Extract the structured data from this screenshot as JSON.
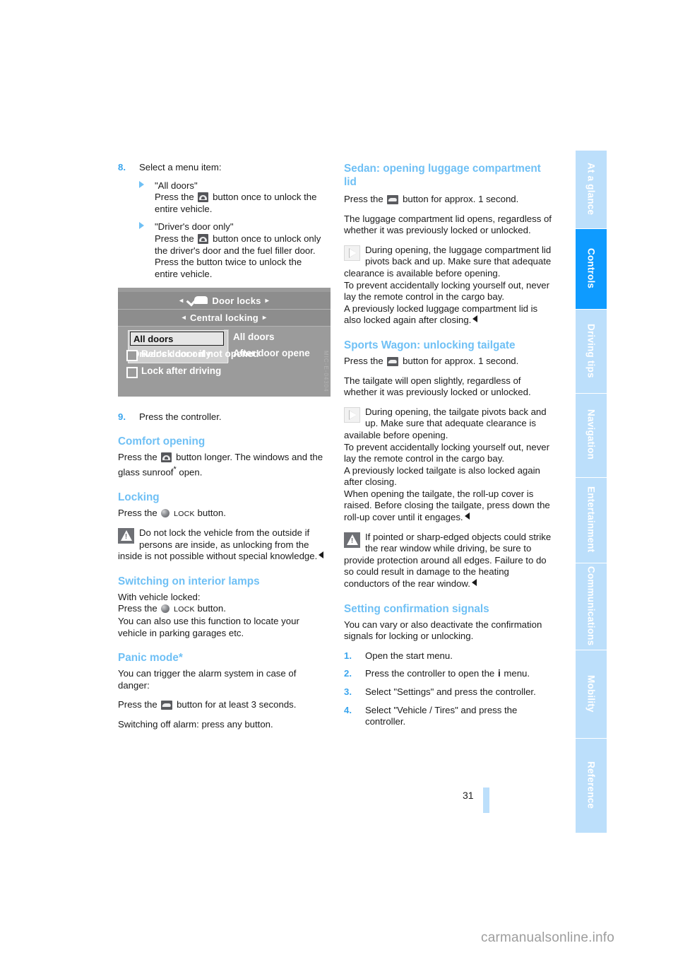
{
  "document": {
    "page_number": "31",
    "watermark": "carmanualsonline.info"
  },
  "tabs": [
    {
      "label": "At a glance",
      "active": false
    },
    {
      "label": "Controls",
      "active": true
    },
    {
      "label": "Driving tips",
      "active": false
    },
    {
      "label": "Navigation",
      "active": false
    },
    {
      "label": "Entertainment",
      "active": false
    },
    {
      "label": "Communications",
      "active": false
    },
    {
      "label": "Mobility",
      "active": false
    },
    {
      "label": "Reference",
      "active": false
    }
  ],
  "colors": {
    "accent_heading": "#6fc0f5",
    "tab_inactive": "#bcdffb",
    "tab_active": "#0e9bff",
    "number_blue": "#3aa5ee"
  },
  "left_column": {
    "step8": {
      "number": "8.",
      "text": "Select a menu item:"
    },
    "bullets": [
      {
        "title": "\"All doors\"",
        "line1_before": "Press the",
        "line1_after": "button once to unlock the",
        "line2": "entire vehicle."
      },
      {
        "title": "\"Driver's door only\"",
        "line1_before": "Press the",
        "line1_after": "button once to unlock only",
        "line2": "the driver's door and the fuel filler door.",
        "line3": "Press the button twice to unlock the",
        "line4": "entire vehicle."
      }
    ],
    "figure": {
      "header1": "Door locks",
      "header2": "Central locking",
      "popup_selected": "All doors",
      "popup_option2": "Driver's door only",
      "right_option1": "All doors",
      "right_option2": "After door opene",
      "check1": "Relock door if not opened",
      "check2": "Lock after driving",
      "arrow_left": "◂",
      "arrow_right": "▸",
      "image_code": "MIC-E-04304"
    },
    "step9": {
      "number": "9.",
      "text": "Press the controller."
    },
    "comfort_opening": {
      "heading": "Comfort opening",
      "line1_before": "Press the",
      "line1_after": "button longer. The windows and",
      "line2_before": "the glass sunroof",
      "line2_star": "*",
      "line2_after": " open."
    },
    "locking": {
      "heading": "Locking",
      "press_before": "Press the",
      "lock_label": "LOCK",
      "press_after": "button.",
      "warning": "Do not lock the vehicle from the outside if persons are inside, as unlocking from the inside is not possible without special knowledge."
    },
    "interior_lamps": {
      "heading": "Switching on interior lamps",
      "line1": "With vehicle locked:",
      "line2_before": "Press the",
      "lock_label": "LOCK",
      "line2_after": "button.",
      "line3": "You can also use this function to locate your vehicle in parking garages etc."
    },
    "panic_mode": {
      "heading": "Panic mode*",
      "line1": "You can trigger the alarm system in case of danger:",
      "line2_before": "Press the",
      "line2_after": "button for at least 3 seconds.",
      "line3": "Switching off alarm: press any button."
    }
  },
  "right_column": {
    "sedan": {
      "heading": "Sedan: opening luggage compartment lid",
      "press_before": "Press the",
      "press_after": "button for approx. 1 second.",
      "para1": "The luggage compartment lid opens, regardless of whether it was previously locked or unlocked.",
      "note": "During opening, the luggage compartment lid pivots back and up. Make sure that adequate clearance is available before opening.",
      "note_line2": "To prevent accidentally locking yourself out, never lay the remote control in the cargo bay.",
      "note_line3": "A previously locked luggage compartment lid is also locked again after closing."
    },
    "wagon": {
      "heading": "Sports Wagon: unlocking tailgate",
      "press_before": "Press the",
      "press_after": "button for approx. 1 second.",
      "para1": "The tailgate will open slightly, regardless of whether it was previously locked or unlocked.",
      "note": "During opening, the tailgate pivots back and up. Make sure that adequate clearance is available before opening.",
      "note_line2": "To prevent accidentally locking yourself out, never lay the remote control in the cargo bay.",
      "note_line3": "A previously locked tailgate is also locked again after closing.",
      "note_line4": "When opening the tailgate, the roll-up cover is raised. Before closing the tailgate, press down the roll-up cover until it engages.",
      "warning": "If pointed or sharp-edged objects could strike the rear window while driving, be sure to provide protection around all edges. Failure to do so could result in damage to the heating conductors of the rear window."
    },
    "confirmation_signals": {
      "heading": "Setting confirmation signals",
      "intro": "You can vary or also deactivate the confirmation signals for locking or unlocking.",
      "steps": [
        {
          "number": "1.",
          "text": "Open the start menu."
        },
        {
          "number": "2.",
          "text_before": "Press the controller to open the",
          "icon": "i",
          "text_after": "menu."
        },
        {
          "number": "3.",
          "text": "Select \"Settings\" and press the controller."
        },
        {
          "number": "4.",
          "text": "Select \"Vehicle / Tires\" and press the controller."
        }
      ]
    }
  }
}
